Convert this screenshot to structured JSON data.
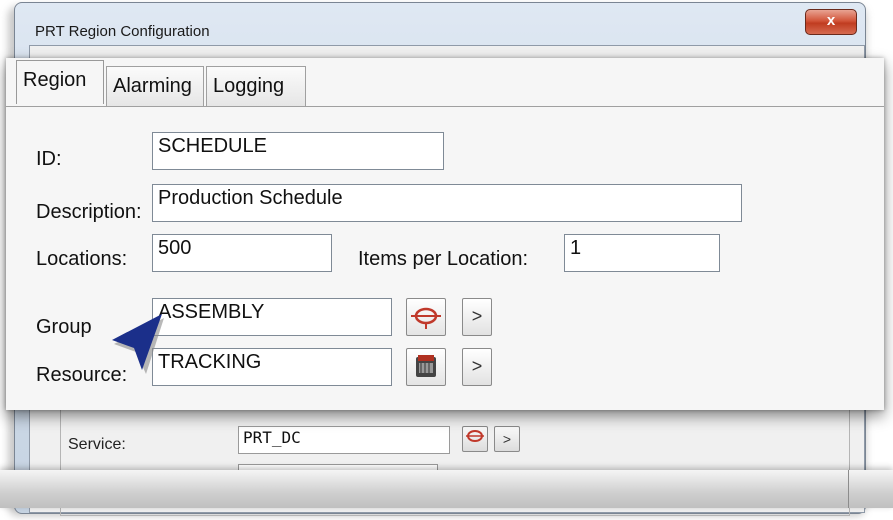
{
  "window": {
    "title": "PRT Region Configuration",
    "close_glyph": "x"
  },
  "background_form": {
    "service_label": "Service:",
    "service_value": "PRT_DC"
  },
  "tabs": [
    {
      "label": "Region",
      "active": true
    },
    {
      "label": "Alarming",
      "active": false
    },
    {
      "label": "Logging",
      "active": false
    }
  ],
  "fields": {
    "id_label": "ID:",
    "id_value": "SCHEDULE",
    "description_label": "Description:",
    "description_value": "Production Schedule",
    "locations_label": "Locations:",
    "locations_value": "500",
    "items_label": "Items per Location:",
    "items_value": "1",
    "group_label": "Group",
    "group_value": "ASSEMBLY",
    "resource_label": "Resource:",
    "resource_value": "TRACKING"
  },
  "buttons": {
    "arrow_glyph": ">"
  },
  "icons": {
    "group_browse": "group-browse-icon",
    "resource_browse": "resource-browse-icon",
    "service_browse": "group-browse-icon"
  },
  "colors": {
    "close_button": "#c03c20",
    "pointer": "#1b2f8a",
    "browse_icon": "#c0392b"
  }
}
